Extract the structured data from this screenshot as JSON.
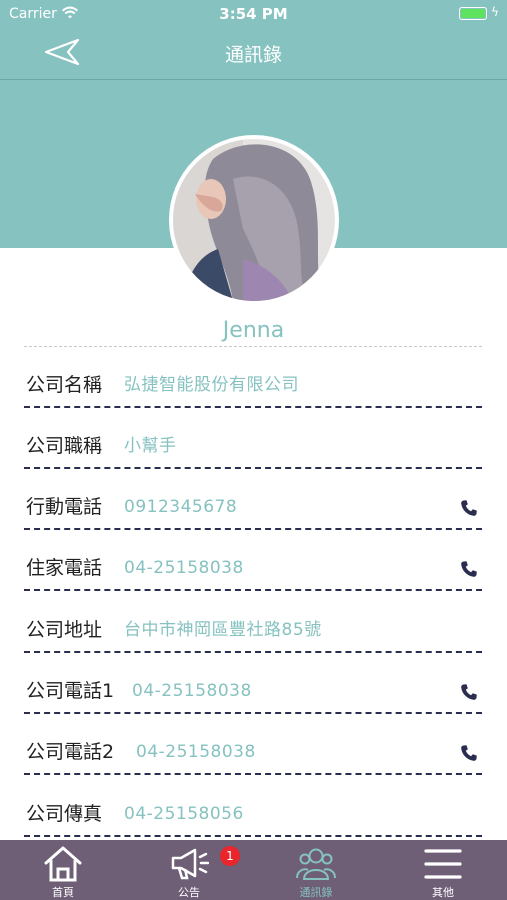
{
  "status_bar": {
    "carrier": "Carrier",
    "time": "3:54 PM",
    "battery_level": 1.0
  },
  "nav": {
    "title": "通訊錄",
    "back_icon": "back-arrow-icon"
  },
  "profile": {
    "name": "Jenna"
  },
  "fields": [
    {
      "label": "公司名稱",
      "value": "弘捷智能股份有限公司",
      "has_phone": false
    },
    {
      "label": "公司職稱",
      "value": "小幫手",
      "has_phone": false
    },
    {
      "label": "行動電話",
      "value": "0912345678",
      "has_phone": true
    },
    {
      "label": "住家電話",
      "value": "04-25158038",
      "has_phone": true
    },
    {
      "label": "公司地址",
      "value": "台中市神岡區豐社路85號",
      "has_phone": false
    },
    {
      "label": "公司電話1",
      "value": "04-25158038",
      "has_phone": true
    },
    {
      "label": "公司電話2",
      "value": "04-25158038",
      "has_phone": true
    },
    {
      "label": "公司傳真",
      "value": "04-25158056",
      "has_phone": false
    }
  ],
  "tab_bar": {
    "tabs": [
      {
        "label": "首頁",
        "icon": "home-icon",
        "active": false
      },
      {
        "label": "公告",
        "icon": "megaphone-icon",
        "active": false,
        "badge": "1"
      },
      {
        "label": "通訊錄",
        "icon": "contacts-icon",
        "active": true
      },
      {
        "label": "其他",
        "icon": "menu-icon",
        "active": false
      }
    ]
  },
  "colors": {
    "teal": "#86c2c0",
    "tab_bar": "#6e5f76",
    "dash": "#2a2d4e",
    "badge": "#e8262c"
  }
}
